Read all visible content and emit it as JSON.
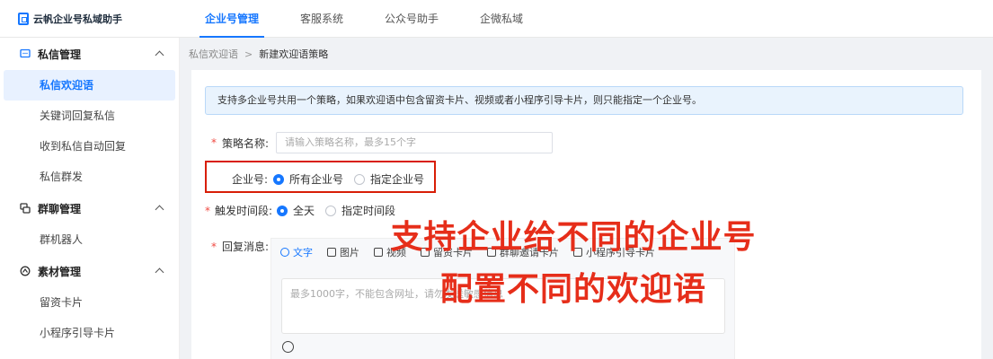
{
  "brand": {
    "name": "云帆企业号私域助手"
  },
  "nav": {
    "items": [
      {
        "label": "企业号管理",
        "active": true
      },
      {
        "label": "客服系统"
      },
      {
        "label": "公众号助手"
      },
      {
        "label": "企微私域"
      }
    ]
  },
  "sidebar": {
    "groups": [
      {
        "label": "私信管理",
        "icon": "message-icon",
        "items": [
          "私信欢迎语",
          "关键词回复私信",
          "收到私信自动回复",
          "私信群发"
        ]
      },
      {
        "label": "群聊管理",
        "icon": "group-chat-icon",
        "items": [
          "群机器人"
        ]
      },
      {
        "label": "素材管理",
        "icon": "material-icon",
        "items": [
          "留资卡片",
          "小程序引导卡片"
        ]
      }
    ],
    "active_item": "私信欢迎语"
  },
  "breadcrumb": {
    "parent": "私信欢迎语",
    "separator": ">",
    "current": "新建欢迎语策略"
  },
  "notice": {
    "text": "支持多企业号共用一个策略，如果欢迎语中包含留资卡片、视频或者小程序引导卡片，则只能指定一个企业号。"
  },
  "form": {
    "strategy_name": {
      "label": "策略名称:",
      "placeholder": "请输入策略名称，最多15个字"
    },
    "account": {
      "label": "企业号:",
      "options": [
        "所有企业号",
        "指定企业号"
      ],
      "selected": "所有企业号"
    },
    "trigger_time": {
      "label": "触发时间段:",
      "options": [
        "全天",
        "指定时间段"
      ],
      "selected": "全天"
    },
    "reply": {
      "label": "回复消息:",
      "tabs": [
        "文字",
        "图片",
        "视频",
        "留资卡片",
        "群聊邀请卡片",
        "小程序引导卡片"
      ],
      "active_tab": "文字",
      "placeholder": "最多1000字，不能包含网址，请勿发送敏感信息"
    }
  },
  "overlay": {
    "line1": "支持企业给不同的企业号",
    "line2": "配置不同的欢迎语"
  },
  "colors": {
    "accent": "#1677ff",
    "highlight_red": "#d81e06",
    "overlay_red": "#e62e1a"
  }
}
